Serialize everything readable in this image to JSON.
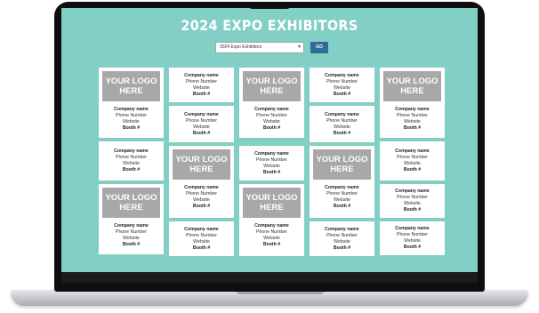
{
  "page": {
    "title": "2024 EXPO EXHIBITORS"
  },
  "filter": {
    "selected": "2024 Expo Exhibitors",
    "button_label": "GO"
  },
  "card_text": {
    "logo_line1": "YOUR LOGO",
    "logo_line2": "HERE",
    "company": "Company name",
    "phone": "Phone Number",
    "website": "Website",
    "booth": "Booth #"
  },
  "grid": {
    "columns": 5,
    "cards": [
      {
        "column": 1,
        "has_logo": true
      },
      {
        "column": 1,
        "has_logo": false
      },
      {
        "column": 1,
        "has_logo": true
      },
      {
        "column": 2,
        "has_logo": false
      },
      {
        "column": 2,
        "has_logo": false
      },
      {
        "column": 2,
        "has_logo": true
      },
      {
        "column": 2,
        "has_logo": false
      },
      {
        "column": 3,
        "has_logo": true
      },
      {
        "column": 3,
        "has_logo": false
      },
      {
        "column": 3,
        "has_logo": true
      },
      {
        "column": 4,
        "has_logo": false
      },
      {
        "column": 4,
        "has_logo": false
      },
      {
        "column": 4,
        "has_logo": true
      },
      {
        "column": 4,
        "has_logo": false
      },
      {
        "column": 5,
        "has_logo": true
      },
      {
        "column": 5,
        "has_logo": false
      },
      {
        "column": 5,
        "has_logo": false
      },
      {
        "column": 5,
        "has_logo": false
      }
    ]
  }
}
